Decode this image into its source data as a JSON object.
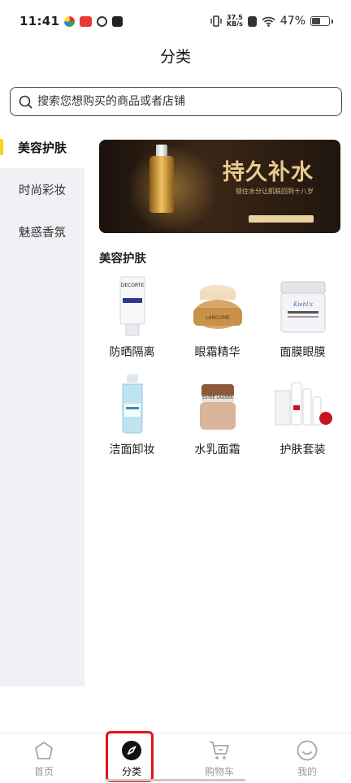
{
  "status_bar": {
    "time": "11:41",
    "net_speed_value": "37.5",
    "net_speed_unit": "KB/s",
    "battery_level": "47%",
    "battery_fraction": 0.47
  },
  "page": {
    "title": "分类"
  },
  "search": {
    "placeholder": "搜索您想购买的商品或者店铺"
  },
  "sidebar": {
    "items": [
      {
        "label": "美容护肤",
        "active": true
      },
      {
        "label": "时尚彩妆",
        "active": false
      },
      {
        "label": "魅惑香氛",
        "active": false
      }
    ]
  },
  "banner": {
    "title": "持久补水",
    "subtitle": "锁住水分让肌肤回到十八岁"
  },
  "section": {
    "title": "美容护肤",
    "items": [
      {
        "label": "防晒隔离",
        "icon": "sunscreen-tube-icon"
      },
      {
        "label": "眼霜精华",
        "icon": "eye-cream-jar-icon"
      },
      {
        "label": "面膜眼膜",
        "icon": "mask-jar-icon"
      },
      {
        "label": "洁面卸妆",
        "icon": "cleanser-bottle-icon"
      },
      {
        "label": "水乳面霜",
        "icon": "face-cream-jar-icon"
      },
      {
        "label": "护肤套装",
        "icon": "skincare-set-icon"
      }
    ]
  },
  "tabbar": {
    "tabs": [
      {
        "label": "首页",
        "icon": "home-icon",
        "active": false
      },
      {
        "label": "分类",
        "icon": "compass-icon",
        "active": true
      },
      {
        "label": "购物车",
        "icon": "cart-icon",
        "active": false
      },
      {
        "label": "我的",
        "icon": "smile-icon",
        "active": false
      }
    ]
  },
  "colors": {
    "accent_indicator": "#ffd21e",
    "active_tab_highlight": "#e0141e",
    "sidebar_bg": "#f1f1f5"
  }
}
